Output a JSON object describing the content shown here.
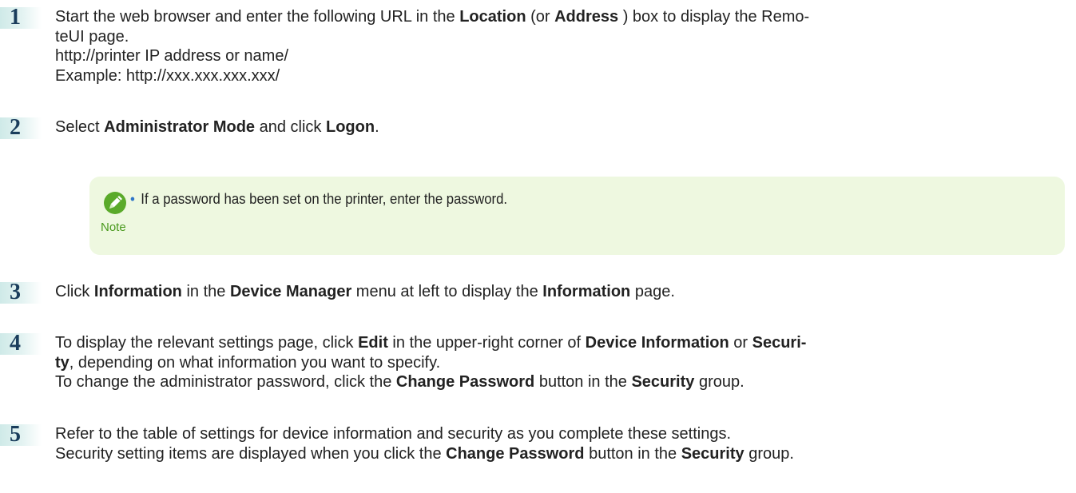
{
  "colors": {
    "step_number": "#1a3d5c",
    "step_badge": "#cfeae8",
    "note_background": "#eef8e0",
    "note_accent": "#4a9a1e",
    "bullet": "#2e75c8"
  },
  "steps": [
    {
      "number": "1",
      "lines": [
        [
          {
            "t": "Start the web browser and enter the following URL in the ",
            "b": false
          },
          {
            "t": "Location",
            "b": true
          },
          {
            "t": " (or ",
            "b": false
          },
          {
            "t": "Address",
            "b": true
          },
          {
            "t": " ) box to display the Remo-",
            "b": false
          }
        ],
        [
          {
            "t": "teUI page.",
            "b": false
          }
        ],
        [
          {
            "t": "http://printer IP address or name/",
            "b": false
          }
        ],
        [
          {
            "t": "Example: http://xxx.xxx.xxx.xxx/",
            "b": false
          }
        ]
      ]
    },
    {
      "number": "2",
      "lines": [
        [
          {
            "t": "Select ",
            "b": false
          },
          {
            "t": "Administrator Mode",
            "b": true
          },
          {
            "t": " and click ",
            "b": false
          },
          {
            "t": "Logon",
            "b": true
          },
          {
            "t": ".",
            "b": false
          }
        ]
      ]
    },
    {
      "number": "3",
      "lines": [
        [
          {
            "t": "Click ",
            "b": false
          },
          {
            "t": "Information",
            "b": true
          },
          {
            "t": " in the ",
            "b": false
          },
          {
            "t": "Device Manager",
            "b": true
          },
          {
            "t": " menu at left to display the ",
            "b": false
          },
          {
            "t": "Information",
            "b": true
          },
          {
            "t": " page.",
            "b": false
          }
        ]
      ]
    },
    {
      "number": "4",
      "lines": [
        [
          {
            "t": "To display the relevant settings page, click ",
            "b": false
          },
          {
            "t": "Edit",
            "b": true
          },
          {
            "t": " in the upper-right corner of ",
            "b": false
          },
          {
            "t": "Device Information",
            "b": true
          },
          {
            "t": " or ",
            "b": false
          },
          {
            "t": "Securi-",
            "b": true
          }
        ],
        [
          {
            "t": "ty",
            "b": true
          },
          {
            "t": ", depending on what information you want to specify.",
            "b": false
          }
        ],
        [
          {
            "t": "To change the administrator password, click the ",
            "b": false
          },
          {
            "t": "Change Password",
            "b": true
          },
          {
            "t": " button in the ",
            "b": false
          },
          {
            "t": "Security",
            "b": true
          },
          {
            "t": " group.",
            "b": false
          }
        ]
      ]
    },
    {
      "number": "5",
      "lines": [
        [
          {
            "t": "Refer to the table of settings for device information and security as you complete these settings.",
            "b": false
          }
        ],
        [
          {
            "t": "Security setting items are displayed when you click the ",
            "b": false
          },
          {
            "t": "Change Password",
            "b": true
          },
          {
            "t": " button in the ",
            "b": false
          },
          {
            "t": "Security",
            "b": true
          },
          {
            "t": " group.",
            "b": false
          }
        ]
      ]
    }
  ],
  "note": {
    "icon": "pencil-note-icon",
    "label": "Note",
    "bullet": "•",
    "text": "If a password has been set on the printer, enter the password."
  }
}
